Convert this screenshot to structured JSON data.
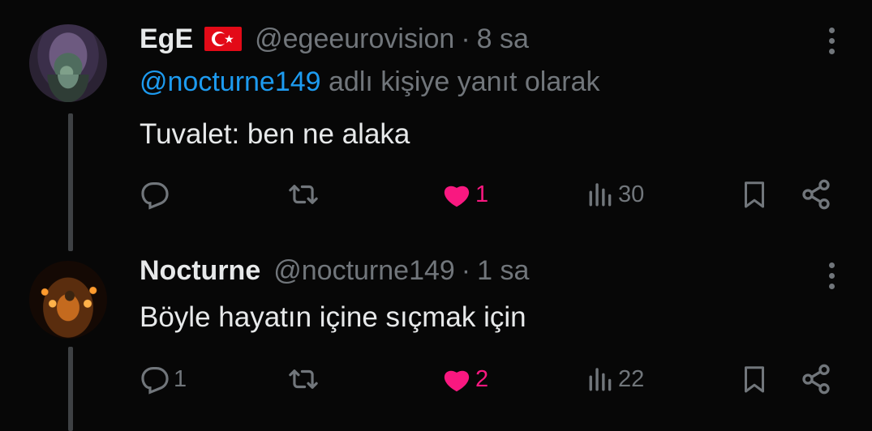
{
  "tweets": [
    {
      "display_name": "EgE",
      "flag_icon": "turkey-flag-icon",
      "handle": "@egeeurovision",
      "separator": "·",
      "time": "8 sa",
      "reply_mention": "@nocturne149",
      "reply_suffix": " adlı kişiye yanıt olarak",
      "text": "Tuvalet: ben ne alaka",
      "replies": "",
      "retweets": "",
      "likes": "1",
      "liked": true,
      "views": "30"
    },
    {
      "display_name": "Nocturne",
      "handle": "@nocturne149",
      "separator": "·",
      "time": "1 sa",
      "text": "Böyle hayatın içine sıçmak için",
      "replies": "1",
      "retweets": "",
      "likes": "2",
      "liked": true,
      "views": "22"
    }
  ],
  "colors": {
    "background": "#070707",
    "text": "#e7e9ea",
    "muted": "#71767b",
    "link": "#1d9bf0",
    "like": "#f91880",
    "turkey_red": "#e30a17"
  },
  "icons": [
    "reply-icon",
    "retweet-icon",
    "heart-icon",
    "views-icon",
    "bookmark-icon",
    "share-icon",
    "more-icon"
  ]
}
